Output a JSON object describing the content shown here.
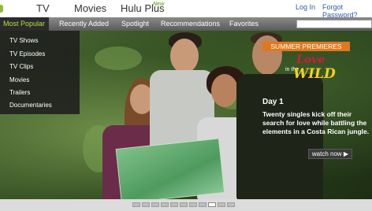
{
  "nav": {
    "tv": "TV",
    "movies": "Movies",
    "huluplus": "Hulu Plus",
    "new_badge": "New",
    "login": "Log In",
    "forgot": "Forgot Password?"
  },
  "subnav": {
    "most_popular": "Most Popular",
    "recently_added": "Recently Added",
    "spotlight": "Spotlight",
    "recommendations": "Recommendations",
    "favorites": "Favorites"
  },
  "dropdown": {
    "items": [
      "TV Shows",
      "TV Episodes",
      "TV Clips",
      "Movies",
      "Trailers",
      "Documentaries"
    ]
  },
  "promo": {
    "banner": "SUMMER PREMIERES",
    "logo_love": "Love",
    "logo_in": "in the",
    "logo_wild": "WILD",
    "day": "Day 1",
    "description": "Twenty singles kick off their search for love while battling the elements in a Costa Rican jungle.",
    "watch_label": "watch now ▶"
  },
  "pager": {
    "count": 11,
    "active_index": 8
  },
  "colors": {
    "accent_green": "#b5e23c",
    "promo_orange": "#e07820",
    "link_blue": "#2a5ea8"
  }
}
